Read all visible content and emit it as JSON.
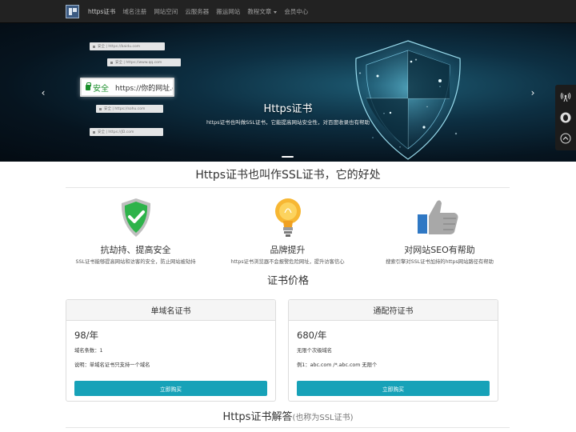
{
  "nav": {
    "items": [
      {
        "label": "https证书",
        "active": true
      },
      {
        "label": "域名注册"
      },
      {
        "label": "网站空间"
      },
      {
        "label": "云服务器"
      },
      {
        "label": "搬运网站"
      },
      {
        "label": "教程文章"
      },
      {
        "label": "会员中心"
      }
    ]
  },
  "hero": {
    "title": "Https证书",
    "subtitle": "https证书也叫做SSL证书，它能提高网站安全性，对百度收录也有帮助",
    "secure_label": "安全",
    "main_url": "https://你的网址.com",
    "url_bars": [
      {
        "text": "安全 | https://baidu.com"
      },
      {
        "text": "安全 | https://www.qq.com"
      },
      {
        "text": "安全 | https://sohu.com"
      },
      {
        "text": "安全 | https://JD.com"
      }
    ]
  },
  "section1": {
    "title": "Https证书也叫作SSL证书，它的好处",
    "features": [
      {
        "title": "抗劫持、提高安全",
        "desc": "SSL证书能够提高网站和访客的安全，防止网站被劫持",
        "icon": "shield-check-icon"
      },
      {
        "title": "品牌提升",
        "desc": "https证书浏览器不会报警危险网址，提升访客信心",
        "icon": "lightbulb-icon"
      },
      {
        "title": "对网站SEO有帮助",
        "desc": "搜索引擎对SSL证书加持的https网站路径有帮助",
        "icon": "thumbs-up-icon"
      }
    ]
  },
  "section2": {
    "title": "证书价格",
    "plans": [
      {
        "name": "单域名证书",
        "price": "98/年",
        "line1": "域名条数：1",
        "line2": "说明：单域名证书只支持一个域名",
        "button": "立即购买"
      },
      {
        "name": "通配符证书",
        "price": "680/年",
        "line1": "无限个次级域名",
        "line2": "例1：abc.com /*.abc.com 无限个",
        "button": "立即购买"
      }
    ]
  },
  "section3": {
    "title": "Https证书解答",
    "title_note": "(也称为SSL证书)"
  },
  "colors": {
    "navbar": "#222222",
    "accent_button": "#17a2b8",
    "secure_green": "#1a8f2b"
  }
}
